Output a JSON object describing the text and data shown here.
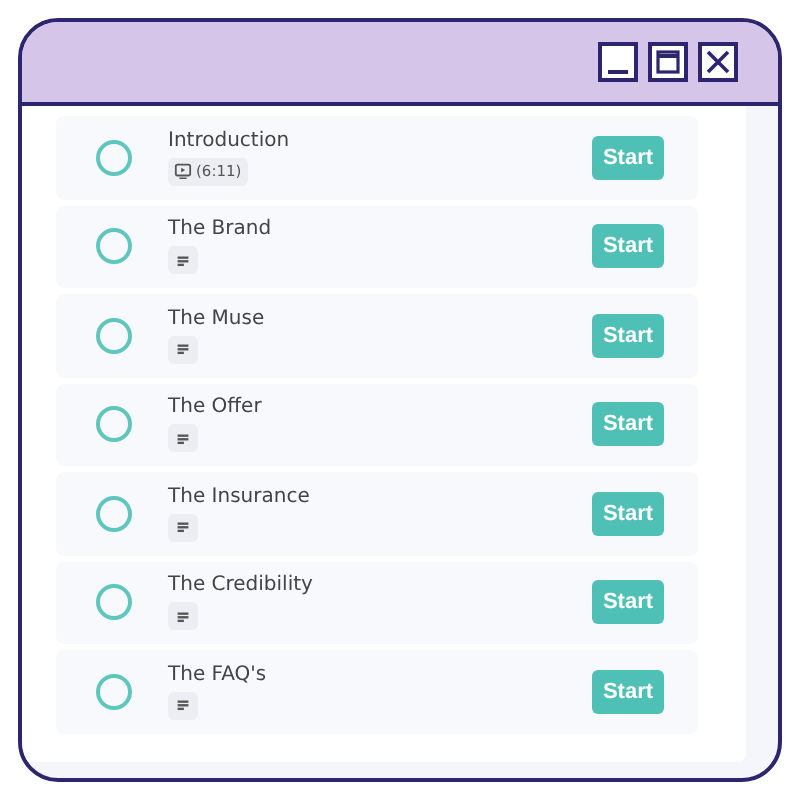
{
  "window": {
    "controls": [
      {
        "kind": "minimize"
      },
      {
        "kind": "maximize"
      },
      {
        "kind": "close"
      }
    ]
  },
  "lessons": [
    {
      "title": "Introduction",
      "kind": "video",
      "duration": "(6:11)",
      "completed": false,
      "action": "Start"
    },
    {
      "title": "The Brand",
      "kind": "text",
      "completed": false,
      "action": "Start"
    },
    {
      "title": "The Muse",
      "kind": "text",
      "completed": false,
      "action": "Start"
    },
    {
      "title": "The Offer",
      "kind": "text",
      "completed": false,
      "action": "Start"
    },
    {
      "title": "The Insurance",
      "kind": "text",
      "completed": false,
      "action": "Start"
    },
    {
      "title": "The Credibility",
      "kind": "text",
      "completed": false,
      "action": "Start"
    },
    {
      "title": "The FAQ's",
      "kind": "text",
      "completed": false,
      "action": "Start"
    }
  ]
}
